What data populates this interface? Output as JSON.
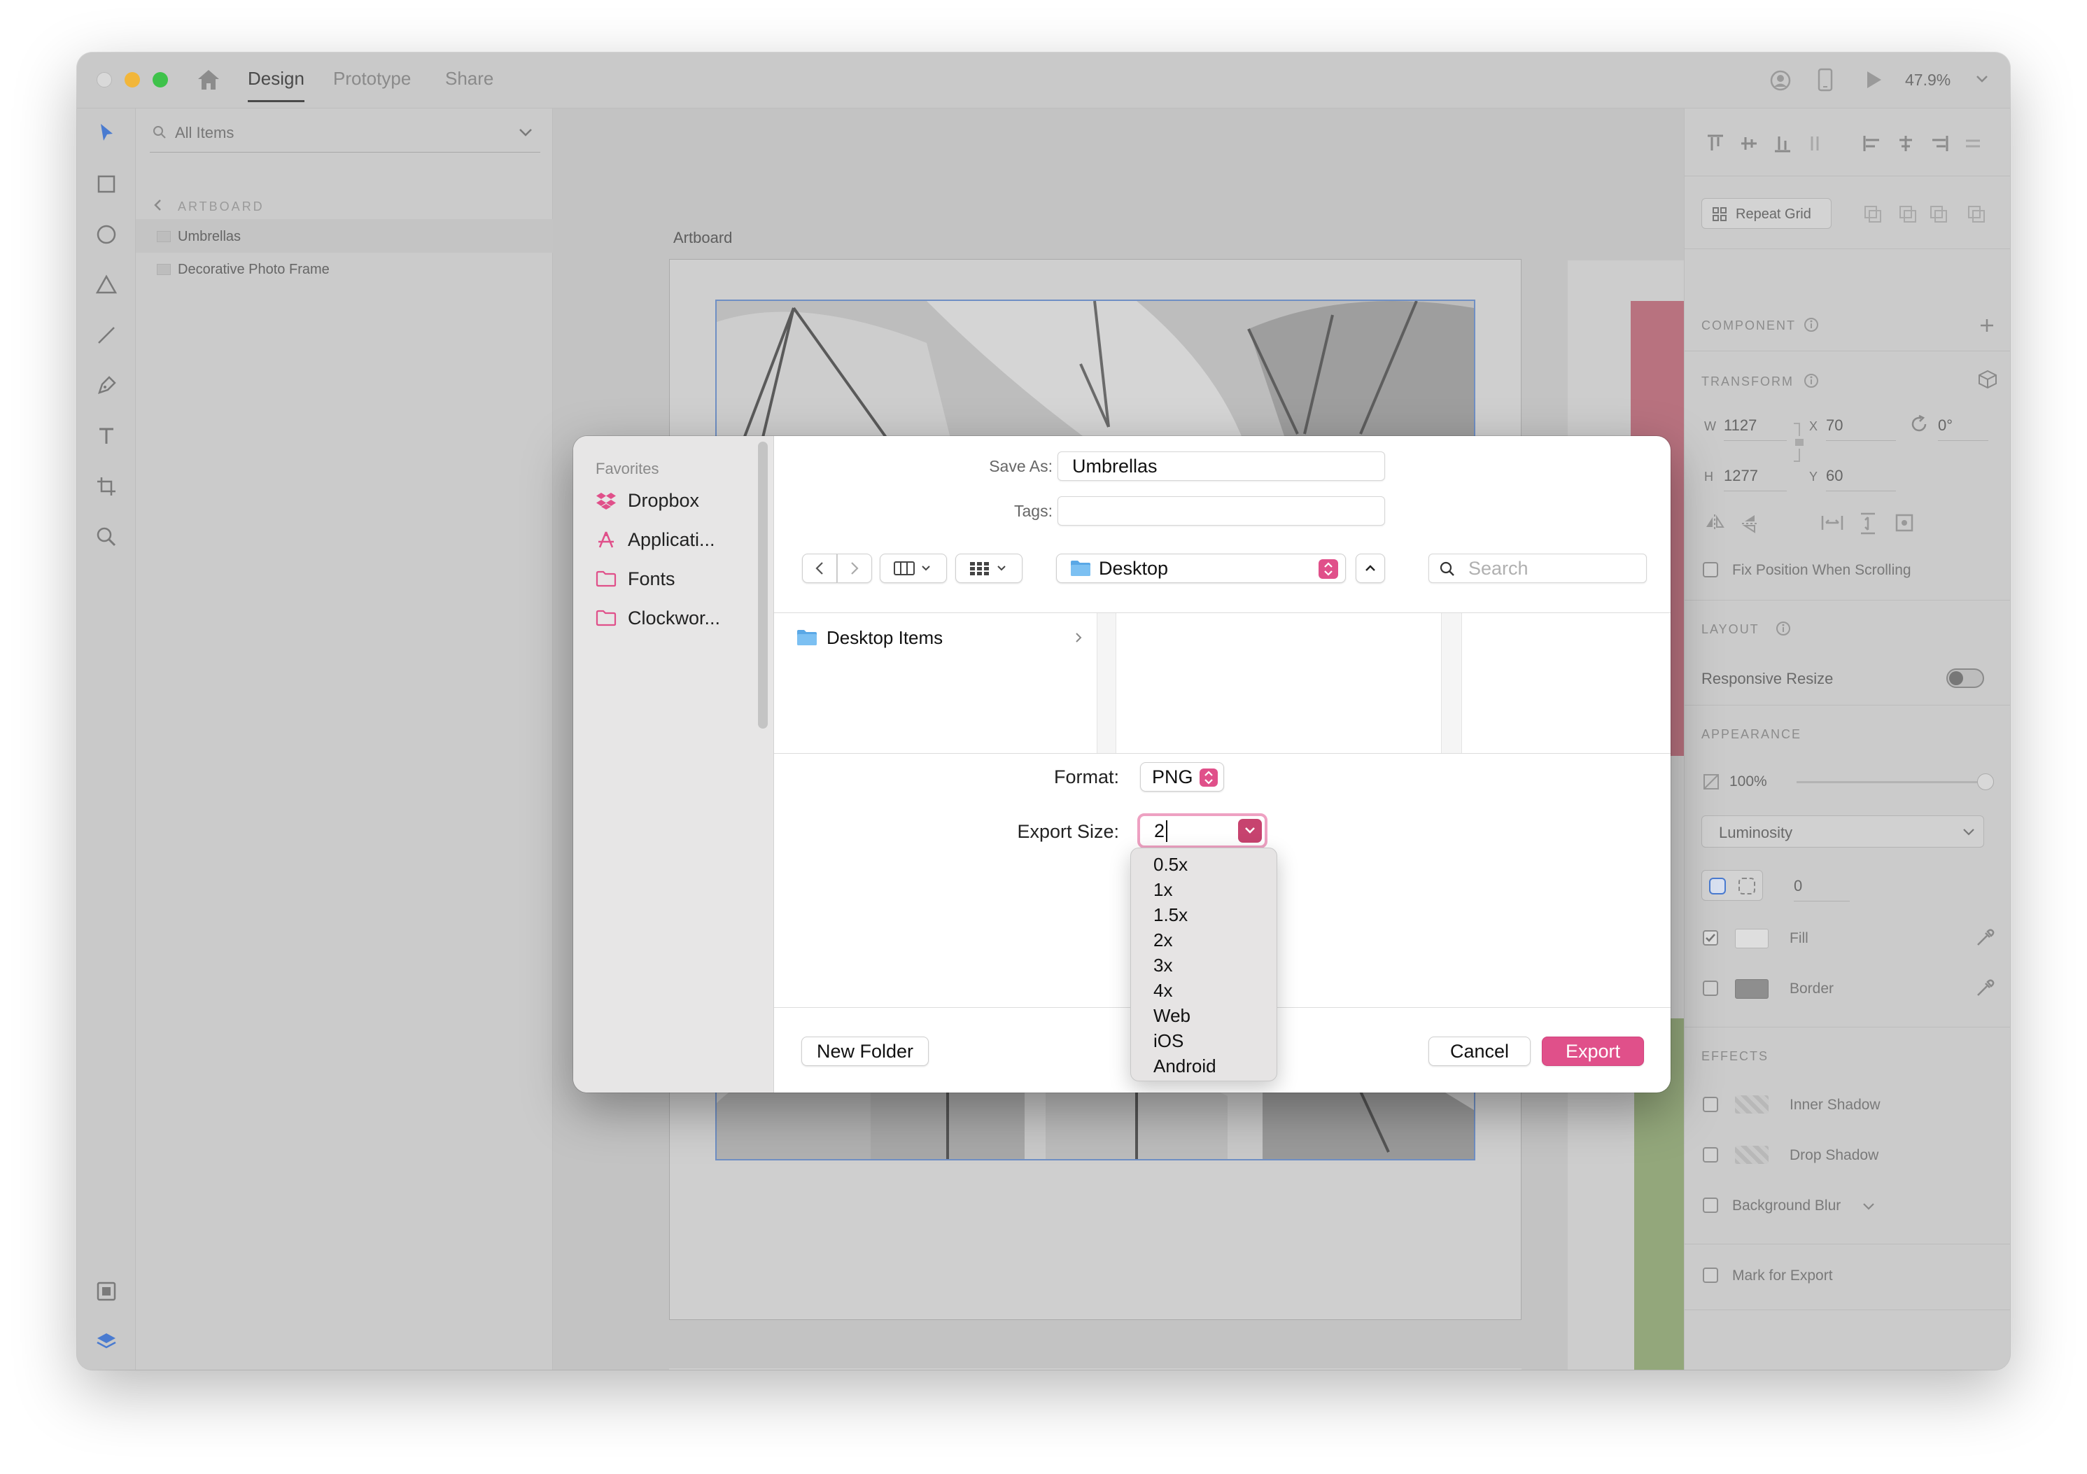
{
  "app": {
    "tabs": [
      "Design",
      "Prototype",
      "Share"
    ],
    "active_tab": "Design",
    "zoom": "47.9%"
  },
  "layers": {
    "search_placeholder": "All Items",
    "section": "ARTBOARD",
    "items": [
      "Umbrellas",
      "Decorative Photo Frame"
    ]
  },
  "canvas": {
    "artboard_label": "Artboard"
  },
  "properties": {
    "repeat_grid": "Repeat Grid",
    "component": "COMPONENT",
    "transform": "TRANSFORM",
    "w_label": "W",
    "w_value": "1127",
    "x_label": "X",
    "x_value": "70",
    "rotation": "0°",
    "h_label": "H",
    "h_value": "1277",
    "y_label": "Y",
    "y_value": "60",
    "fix_position": "Fix Position When Scrolling",
    "layout": "LAYOUT",
    "responsive_resize": "Responsive Resize",
    "appearance": "APPEARANCE",
    "opacity": "100%",
    "blend_mode": "Luminosity",
    "corner_radius": "0",
    "fill": "Fill",
    "border": "Border",
    "effects": "EFFECTS",
    "inner_shadow": "Inner Shadow",
    "drop_shadow": "Drop Shadow",
    "background_blur": "Background Blur",
    "mark_for_export": "Mark for Export"
  },
  "dialog": {
    "favorites_title": "Favorites",
    "favorites": [
      "Dropbox",
      "Applicati...",
      "Fonts",
      "Clockwor..."
    ],
    "save_as_label": "Save As:",
    "save_as_value": "Umbrellas",
    "tags_label": "Tags:",
    "location": "Desktop",
    "search_placeholder": "Search",
    "folder_item": "Desktop Items",
    "format_label": "Format:",
    "format_value": "PNG",
    "export_size_label": "Export Size:",
    "export_size_value": "2",
    "size_options": [
      "0.5x",
      "1x",
      "1.5x",
      "2x",
      "3x",
      "4x",
      "Web",
      "iOS",
      "Android"
    ],
    "new_folder": "New Folder",
    "cancel": "Cancel",
    "export": "Export"
  },
  "colors": {
    "accent": "#e0508a",
    "pink_block": "#b8727f",
    "green_block": "#93a77b",
    "orange_block": "#d5a574"
  }
}
